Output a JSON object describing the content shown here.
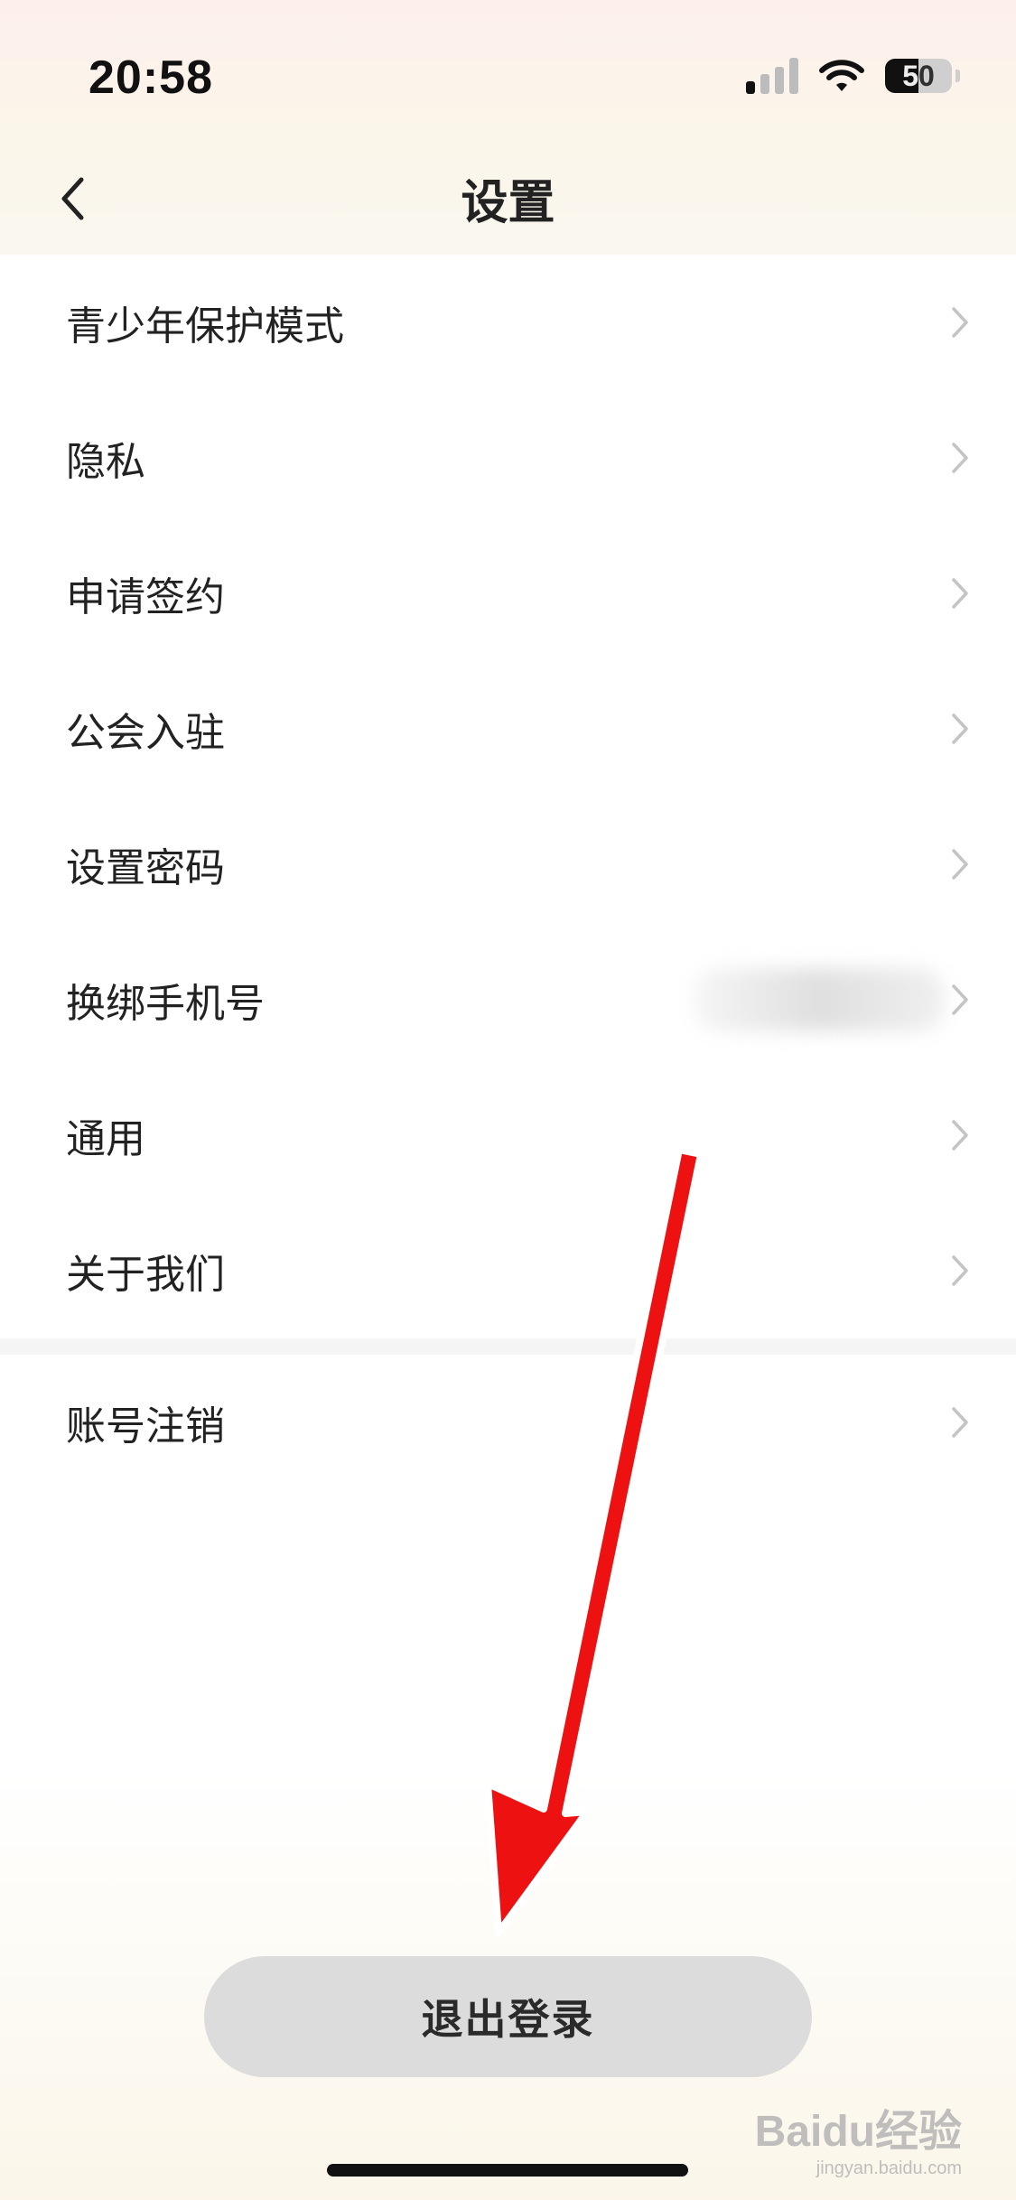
{
  "status_bar": {
    "time": "20:58",
    "battery_level": "50",
    "signal_bars_active": 1,
    "signal_bars_total": 4
  },
  "nav": {
    "title": "设置"
  },
  "menu": {
    "group1": [
      {
        "label": "青少年保护模式"
      },
      {
        "label": "隐私"
      },
      {
        "label": "申请签约"
      },
      {
        "label": "公会入驻"
      },
      {
        "label": "设置密码"
      },
      {
        "label": "换绑手机号",
        "value_blurred": true
      },
      {
        "label": "通用"
      },
      {
        "label": "关于我们"
      }
    ],
    "group2": [
      {
        "label": "账号注销"
      }
    ]
  },
  "logout": {
    "label": "退出登录"
  },
  "watermark": {
    "brand": "Baidu经验",
    "url": "jingyan.baidu.com"
  },
  "colors": {
    "arrow": "#ee1111",
    "button_bg": "#dcdcdc",
    "chevron": "#c4c4c4"
  }
}
